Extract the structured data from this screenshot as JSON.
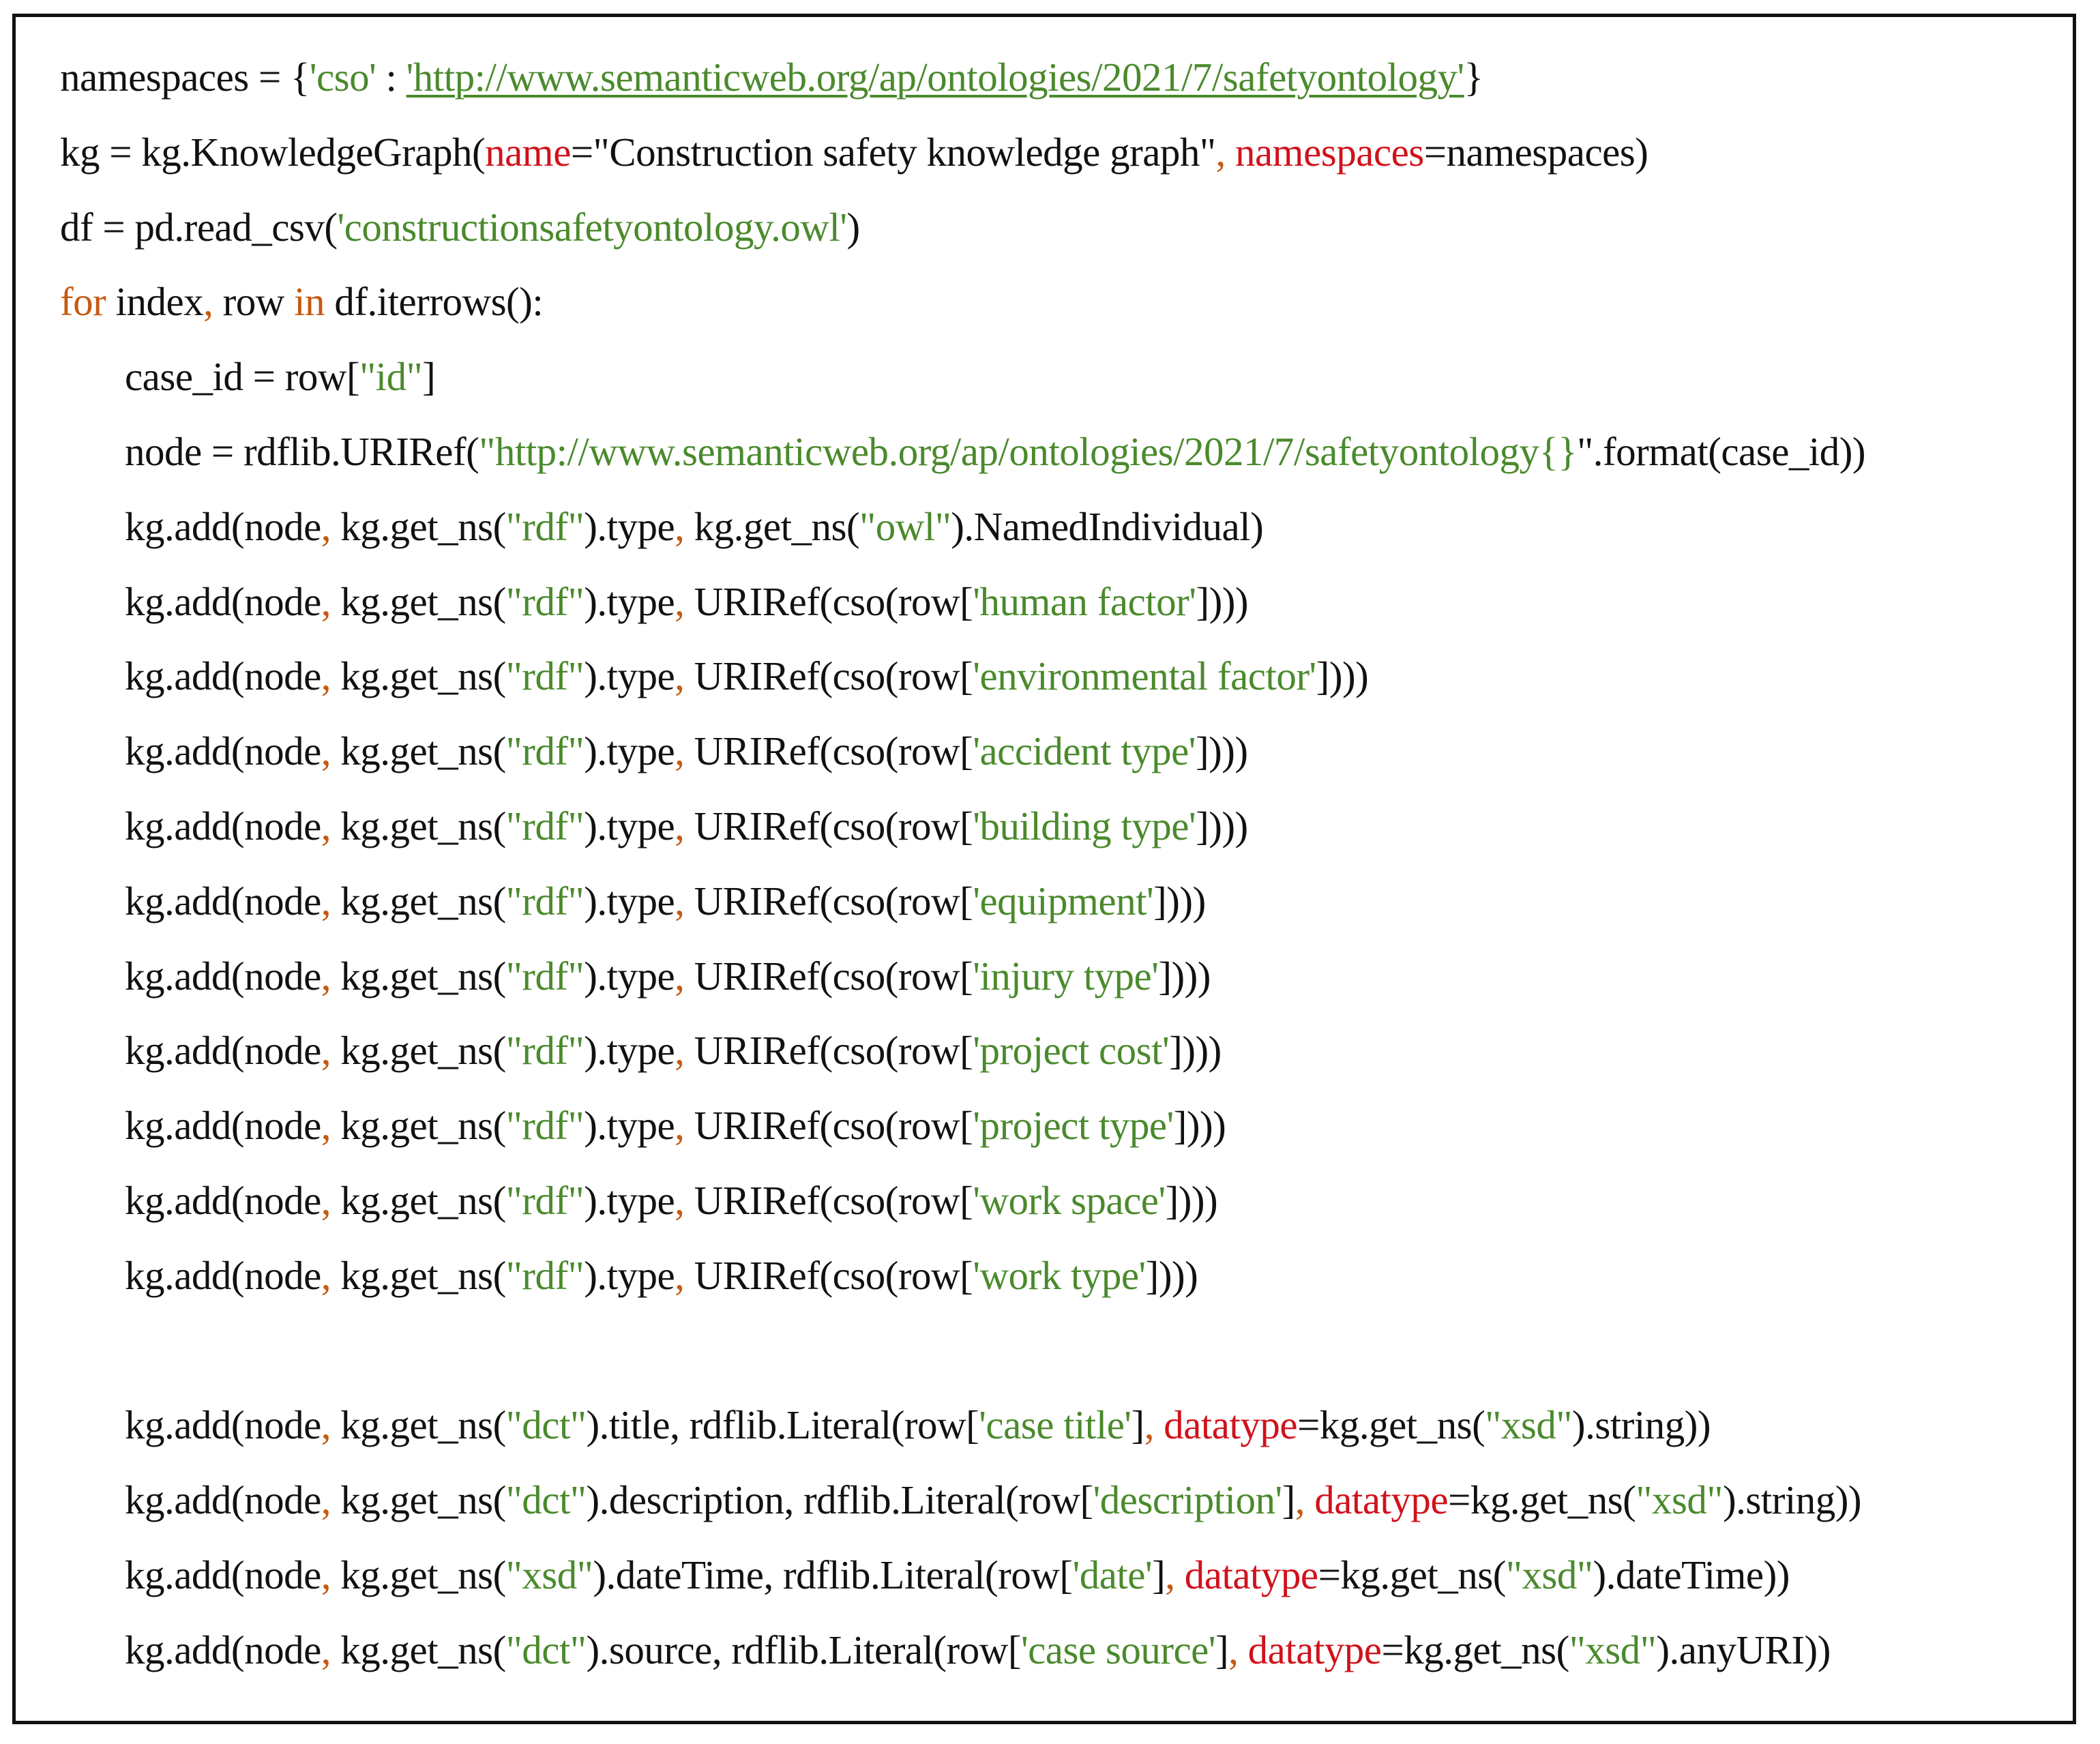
{
  "colors": {
    "k": "#111111",
    "g": "#4a8a2c",
    "r": "#d0121b",
    "o": "#c55a11"
  },
  "lines": [
    {
      "indent": false,
      "tokens": [
        {
          "t": "namespaces = {",
          "c": "k"
        },
        {
          "t": "'cso'",
          "c": "g"
        },
        {
          "t": " : ",
          "c": "k"
        },
        {
          "t": "'http://www.semanticweb.org/ap/ontologies/2021/7/safetyontology'",
          "c": "u"
        },
        {
          "t": "}",
          "c": "k"
        }
      ]
    },
    {
      "indent": false,
      "tokens": [
        {
          "t": "kg = kg.KnowledgeGraph(",
          "c": "k"
        },
        {
          "t": "name",
          "c": "r"
        },
        {
          "t": "=\"Construction safety knowledge graph\"",
          "c": "k"
        },
        {
          "t": ",",
          "c": "o"
        },
        {
          "t": " ",
          "c": "k"
        },
        {
          "t": "namespaces",
          "c": "r"
        },
        {
          "t": "=namespaces)",
          "c": "k"
        }
      ]
    },
    {
      "indent": false,
      "tokens": [
        {
          "t": "df = pd.read_csv(",
          "c": "k"
        },
        {
          "t": "'constructionsafetyontology.owl'",
          "c": "g"
        },
        {
          "t": ")",
          "c": "k"
        }
      ]
    },
    {
      "indent": false,
      "tokens": [
        {
          "t": "for",
          "c": "o"
        },
        {
          "t": " index",
          "c": "k"
        },
        {
          "t": ",",
          "c": "o"
        },
        {
          "t": " row ",
          "c": "k"
        },
        {
          "t": "in",
          "c": "o"
        },
        {
          "t": " df.iterrows():",
          "c": "k"
        }
      ]
    },
    {
      "indent": true,
      "tokens": [
        {
          "t": "case_id = row[",
          "c": "k"
        },
        {
          "t": "\"id\"",
          "c": "g"
        },
        {
          "t": "]",
          "c": "k"
        }
      ]
    },
    {
      "indent": true,
      "tokens": [
        {
          "t": "node = rdflib.URIRef(",
          "c": "k"
        },
        {
          "t": "\"http://www.semanticweb.org/ap/ontologies/2021/7/safetyontology{}",
          "c": "g"
        },
        {
          "t": "\".format(case_id))",
          "c": "k"
        }
      ]
    },
    {
      "indent": true,
      "tokens": [
        {
          "t": "kg.add(node",
          "c": "k"
        },
        {
          "t": ",",
          "c": "o"
        },
        {
          "t": " kg.get_ns(",
          "c": "k"
        },
        {
          "t": "\"rdf\"",
          "c": "g"
        },
        {
          "t": ").type",
          "c": "k"
        },
        {
          "t": ",",
          "c": "o"
        },
        {
          "t": " kg.get_ns(",
          "c": "k"
        },
        {
          "t": "\"owl\"",
          "c": "g"
        },
        {
          "t": ").NamedIndividual)",
          "c": "k"
        }
      ]
    },
    {
      "indent": true,
      "tokens": [
        {
          "t": "kg.add(node",
          "c": "k"
        },
        {
          "t": ",",
          "c": "o"
        },
        {
          "t": " kg.get_ns(",
          "c": "k"
        },
        {
          "t": "\"rdf\"",
          "c": "g"
        },
        {
          "t": ").type",
          "c": "k"
        },
        {
          "t": ",",
          "c": "o"
        },
        {
          "t": " URIRef(cso(row[",
          "c": "k"
        },
        {
          "t": "'human factor'",
          "c": "g"
        },
        {
          "t": "])))",
          "c": "k"
        }
      ]
    },
    {
      "indent": true,
      "tokens": [
        {
          "t": "kg.add(node",
          "c": "k"
        },
        {
          "t": ",",
          "c": "o"
        },
        {
          "t": " kg.get_ns(",
          "c": "k"
        },
        {
          "t": "\"rdf\"",
          "c": "g"
        },
        {
          "t": ").type",
          "c": "k"
        },
        {
          "t": ",",
          "c": "o"
        },
        {
          "t": " URIRef(cso(row[",
          "c": "k"
        },
        {
          "t": "'environmental factor'",
          "c": "g"
        },
        {
          "t": "])))",
          "c": "k"
        }
      ]
    },
    {
      "indent": true,
      "tokens": [
        {
          "t": "kg.add(node",
          "c": "k"
        },
        {
          "t": ",",
          "c": "o"
        },
        {
          "t": " kg.get_ns(",
          "c": "k"
        },
        {
          "t": "\"rdf\"",
          "c": "g"
        },
        {
          "t": ").type",
          "c": "k"
        },
        {
          "t": ",",
          "c": "o"
        },
        {
          "t": " URIRef(cso(row[",
          "c": "k"
        },
        {
          "t": "'accident type'",
          "c": "g"
        },
        {
          "t": "])))",
          "c": "k"
        }
      ]
    },
    {
      "indent": true,
      "tokens": [
        {
          "t": "kg.add(node",
          "c": "k"
        },
        {
          "t": ",",
          "c": "o"
        },
        {
          "t": " kg.get_ns(",
          "c": "k"
        },
        {
          "t": "\"rdf\"",
          "c": "g"
        },
        {
          "t": ").type",
          "c": "k"
        },
        {
          "t": ",",
          "c": "o"
        },
        {
          "t": " URIRef(cso(row[",
          "c": "k"
        },
        {
          "t": "'building type'",
          "c": "g"
        },
        {
          "t": "])))",
          "c": "k"
        }
      ]
    },
    {
      "indent": true,
      "tokens": [
        {
          "t": "kg.add(node",
          "c": "k"
        },
        {
          "t": ",",
          "c": "o"
        },
        {
          "t": " kg.get_ns(",
          "c": "k"
        },
        {
          "t": "\"rdf\"",
          "c": "g"
        },
        {
          "t": ").type",
          "c": "k"
        },
        {
          "t": ",",
          "c": "o"
        },
        {
          "t": " URIRef(cso(row[",
          "c": "k"
        },
        {
          "t": "'equipment'",
          "c": "g"
        },
        {
          "t": "])))",
          "c": "k"
        }
      ]
    },
    {
      "indent": true,
      "tokens": [
        {
          "t": "kg.add(node",
          "c": "k"
        },
        {
          "t": ",",
          "c": "o"
        },
        {
          "t": " kg.get_ns(",
          "c": "k"
        },
        {
          "t": "\"rdf\"",
          "c": "g"
        },
        {
          "t": ").type",
          "c": "k"
        },
        {
          "t": ",",
          "c": "o"
        },
        {
          "t": " URIRef(cso(row[",
          "c": "k"
        },
        {
          "t": "'injury type'",
          "c": "g"
        },
        {
          "t": "])))",
          "c": "k"
        }
      ]
    },
    {
      "indent": true,
      "tokens": [
        {
          "t": "kg.add(node",
          "c": "k"
        },
        {
          "t": ",",
          "c": "o"
        },
        {
          "t": " kg.get_ns(",
          "c": "k"
        },
        {
          "t": "\"rdf\"",
          "c": "g"
        },
        {
          "t": ").type",
          "c": "k"
        },
        {
          "t": ",",
          "c": "o"
        },
        {
          "t": " URIRef(cso(row[",
          "c": "k"
        },
        {
          "t": "'project cost'",
          "c": "g"
        },
        {
          "t": "])))",
          "c": "k"
        }
      ]
    },
    {
      "indent": true,
      "tokens": [
        {
          "t": "kg.add(node",
          "c": "k"
        },
        {
          "t": ",",
          "c": "o"
        },
        {
          "t": " kg.get_ns(",
          "c": "k"
        },
        {
          "t": "\"rdf\"",
          "c": "g"
        },
        {
          "t": ").type",
          "c": "k"
        },
        {
          "t": ",",
          "c": "o"
        },
        {
          "t": " URIRef(cso(row[",
          "c": "k"
        },
        {
          "t": "'project type'",
          "c": "g"
        },
        {
          "t": "])))",
          "c": "k"
        }
      ]
    },
    {
      "indent": true,
      "tokens": [
        {
          "t": "kg.add(node",
          "c": "k"
        },
        {
          "t": ",",
          "c": "o"
        },
        {
          "t": " kg.get_ns(",
          "c": "k"
        },
        {
          "t": "\"rdf\"",
          "c": "g"
        },
        {
          "t": ").type",
          "c": "k"
        },
        {
          "t": ",",
          "c": "o"
        },
        {
          "t": " URIRef(cso(row[",
          "c": "k"
        },
        {
          "t": "'work space'",
          "c": "g"
        },
        {
          "t": "])))",
          "c": "k"
        }
      ]
    },
    {
      "indent": true,
      "tokens": [
        {
          "t": "kg.add(node",
          "c": "k"
        },
        {
          "t": ",",
          "c": "o"
        },
        {
          "t": " kg.get_ns(",
          "c": "k"
        },
        {
          "t": "\"rdf\"",
          "c": "g"
        },
        {
          "t": ").type",
          "c": "k"
        },
        {
          "t": ",",
          "c": "o"
        },
        {
          "t": " URIRef(cso(row[",
          "c": "k"
        },
        {
          "t": "'work type'",
          "c": "g"
        },
        {
          "t": "])))",
          "c": "k"
        }
      ]
    },
    {
      "indent": true,
      "tokens": []
    },
    {
      "indent": true,
      "tokens": [
        {
          "t": "kg.add(node",
          "c": "k"
        },
        {
          "t": ",",
          "c": "o"
        },
        {
          "t": " kg.get_ns(",
          "c": "k"
        },
        {
          "t": "\"dct\"",
          "c": "g"
        },
        {
          "t": ").title, rdflib.Literal(row[",
          "c": "k"
        },
        {
          "t": "'case title'",
          "c": "g"
        },
        {
          "t": "]",
          "c": "k"
        },
        {
          "t": ",",
          "c": "o"
        },
        {
          "t": " ",
          "c": "k"
        },
        {
          "t": "datatype",
          "c": "r"
        },
        {
          "t": "=kg.get_ns(",
          "c": "k"
        },
        {
          "t": "\"xsd\"",
          "c": "g"
        },
        {
          "t": ").string))",
          "c": "k"
        }
      ]
    },
    {
      "indent": true,
      "tokens": [
        {
          "t": "kg.add(node",
          "c": "k"
        },
        {
          "t": ",",
          "c": "o"
        },
        {
          "t": " kg.get_ns(",
          "c": "k"
        },
        {
          "t": "\"dct\"",
          "c": "g"
        },
        {
          "t": ").description, rdflib.Literal(row[",
          "c": "k"
        },
        {
          "t": "'description'",
          "c": "g"
        },
        {
          "t": "]",
          "c": "k"
        },
        {
          "t": ",",
          "c": "o"
        },
        {
          "t": " ",
          "c": "k"
        },
        {
          "t": "datatype",
          "c": "r"
        },
        {
          "t": "=kg.get_ns(",
          "c": "k"
        },
        {
          "t": "\"xsd\"",
          "c": "g"
        },
        {
          "t": ").string))",
          "c": "k"
        }
      ]
    },
    {
      "indent": true,
      "tokens": [
        {
          "t": "kg.add(node",
          "c": "k"
        },
        {
          "t": ",",
          "c": "o"
        },
        {
          "t": " kg.get_ns(",
          "c": "k"
        },
        {
          "t": "\"xsd\"",
          "c": "g"
        },
        {
          "t": ").dateTime, rdflib.Literal(row[",
          "c": "k"
        },
        {
          "t": "'date'",
          "c": "g"
        },
        {
          "t": "]",
          "c": "k"
        },
        {
          "t": ",",
          "c": "o"
        },
        {
          "t": " ",
          "c": "k"
        },
        {
          "t": "datatype",
          "c": "r"
        },
        {
          "t": "=kg.get_ns(",
          "c": "k"
        },
        {
          "t": "\"xsd\"",
          "c": "g"
        },
        {
          "t": ").dateTime))",
          "c": "k"
        }
      ]
    },
    {
      "indent": true,
      "tokens": [
        {
          "t": "kg.add(node",
          "c": "k"
        },
        {
          "t": ",",
          "c": "o"
        },
        {
          "t": " kg.get_ns(",
          "c": "k"
        },
        {
          "t": "\"dct\"",
          "c": "g"
        },
        {
          "t": ").source, rdflib.Literal(row[",
          "c": "k"
        },
        {
          "t": "'case source'",
          "c": "g"
        },
        {
          "t": "]",
          "c": "k"
        },
        {
          "t": ",",
          "c": "o"
        },
        {
          "t": " ",
          "c": "k"
        },
        {
          "t": "datatype",
          "c": "r"
        },
        {
          "t": "=kg.get_ns(",
          "c": "k"
        },
        {
          "t": "\"xsd\"",
          "c": "g"
        },
        {
          "t": ").anyURI))",
          "c": "k"
        }
      ]
    }
  ]
}
